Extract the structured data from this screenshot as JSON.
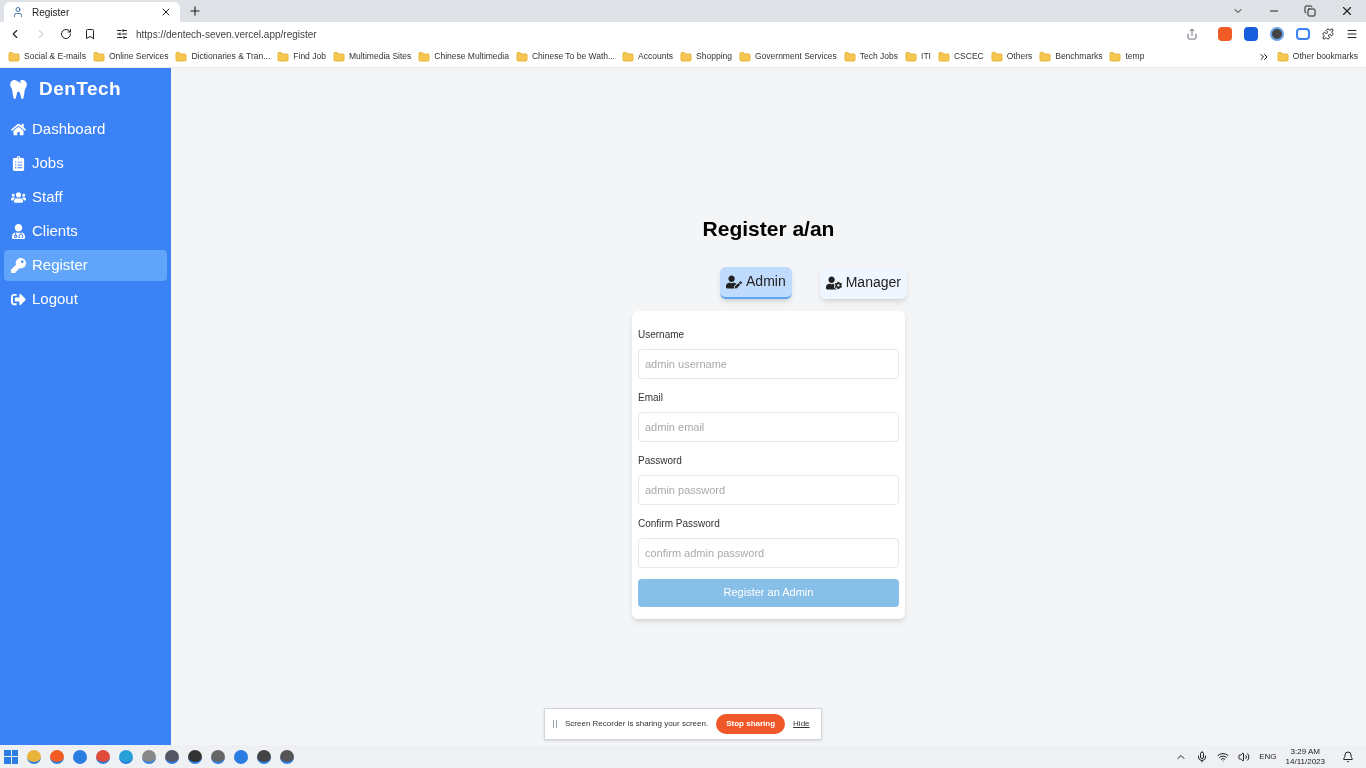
{
  "browser": {
    "tab_title": "Register",
    "url": "https://dentech-seven.vercel.app/register",
    "bookmarks": [
      "Social & E-mails",
      "Online Services",
      "Dictionaries & Tran...",
      "Find Job",
      "Multimedia Sites",
      "Chinese Multimedia",
      "Chinese To be Wath...",
      "Accounts",
      "Shopping",
      "Government Services",
      "Tech Jobs",
      "ITI",
      "CSCEC",
      "Others",
      "Benchmarks",
      "temp"
    ],
    "other_bookmarks": "Other bookmarks"
  },
  "sidebar": {
    "brand": "DenTech",
    "items": [
      {
        "label": "Dashboard",
        "kind": "home",
        "selected": false
      },
      {
        "label": "Jobs",
        "kind": "clipboard",
        "selected": false
      },
      {
        "label": "Staff",
        "kind": "group",
        "selected": false
      },
      {
        "label": "Clients",
        "kind": "person",
        "selected": false
      },
      {
        "label": "Register",
        "kind": "key",
        "selected": true
      },
      {
        "label": "Logout",
        "kind": "exit",
        "selected": false
      }
    ]
  },
  "heading": "Register a/an",
  "roles": [
    {
      "label": "Admin",
      "kind": "edit",
      "selected": true
    },
    {
      "label": "Manager",
      "kind": "cog",
      "selected": false
    }
  ],
  "form": {
    "fields": [
      {
        "label": "Username",
        "placeholder": "admin username"
      },
      {
        "label": "Email",
        "placeholder": "admin email"
      },
      {
        "label": "Password",
        "placeholder": "admin password"
      },
      {
        "label": "Confirm Password",
        "placeholder": "confirm admin password"
      }
    ],
    "submit": "Register an Admin",
    "submit_disabled": true
  },
  "share_bar": {
    "message": "Screen Recorder is sharing your screen.",
    "stop": "Stop sharing",
    "hide": "Hide"
  },
  "taskbar": {
    "language": "ENG",
    "time": "3:29 AM",
    "date": "14/11/2023"
  }
}
